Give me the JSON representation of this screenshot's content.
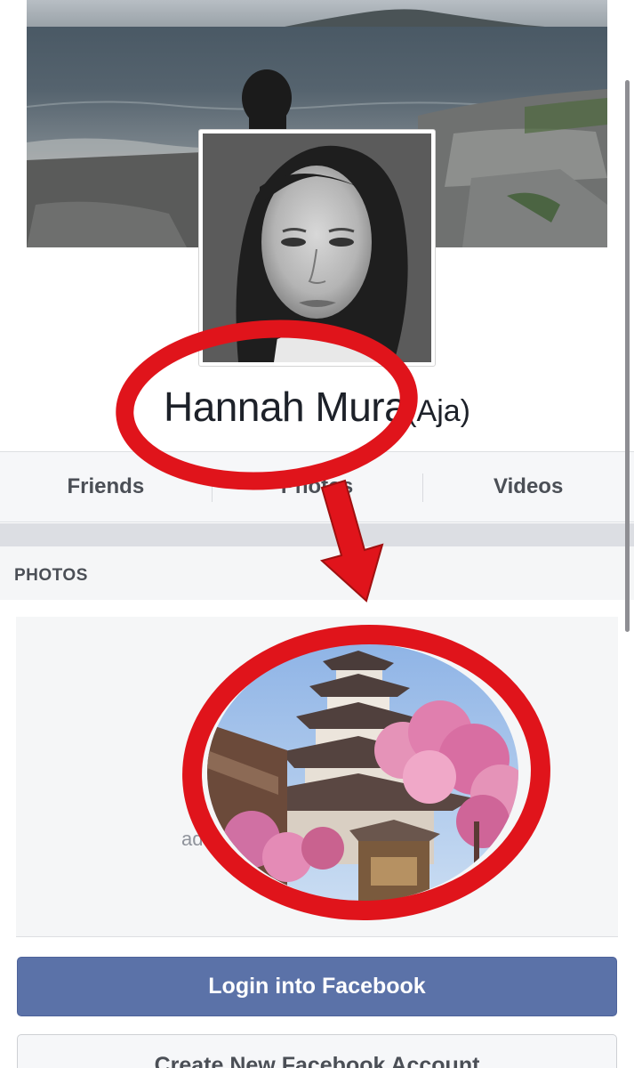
{
  "profile": {
    "name": "Hannah Mura",
    "alternate_name": "(Aja)"
  },
  "tabs": [
    {
      "label": "Friends"
    },
    {
      "label": "Photos"
    },
    {
      "label": "Videos"
    }
  ],
  "photos_section": {
    "heading": "PHOTOS",
    "partial_text": "ad"
  },
  "buttons": {
    "login": "Login into Facebook",
    "create_account": "Create New Facebook Account"
  },
  "colors": {
    "primary_button": "#5b72a8",
    "annotation_red": "#e0141b"
  },
  "icons": {
    "annotation_arrow": "arrow-down-icon"
  }
}
